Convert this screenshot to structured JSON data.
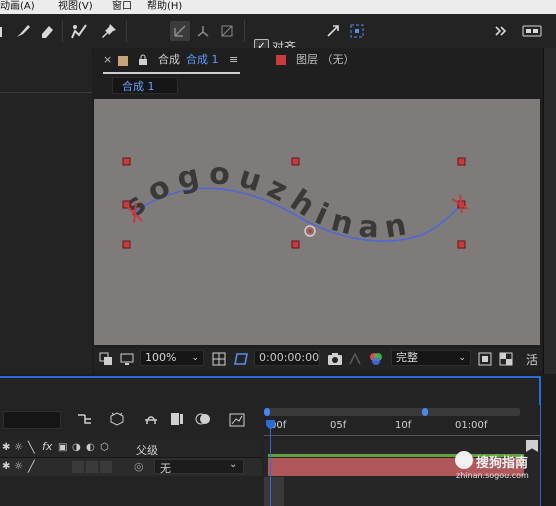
{
  "menu": {
    "items": [
      "动画(A)",
      "视图(V)",
      "窗口",
      "帮助(H)"
    ]
  },
  "toolbar": {
    "snap_label": "对齐",
    "snap_checked": true,
    "icons": [
      "paint-brush-icon",
      "eraser-icon",
      "roto-brush-icon",
      "puppet-pin-icon",
      "axis-local-icon",
      "axis-world-icon",
      "axis-view-icon",
      "snap-icon",
      "expand-icon",
      "workspace-icon"
    ]
  },
  "composition_panel": {
    "close_symbol": "×",
    "lock_symbol": "🔒",
    "title_prefix": "合成",
    "title_active": "合成 1",
    "menu_symbol": "≡",
    "layer_tab": "图层 （无）",
    "subtab": "合成 1",
    "accent_color": "#c9a27a"
  },
  "canvas": {
    "text": "sogouzhinan",
    "text_color": "#3b3838",
    "background": "#7f7b7a",
    "path_color": "#4e67d8"
  },
  "viewer_controls": {
    "zoom": "100%",
    "timecode": "0:00:00:00",
    "resolution": "完整",
    "truncated_label": "活"
  },
  "timeline": {
    "ruler_labels": [
      "00f",
      "05f",
      "10f",
      "01:00f"
    ],
    "column_header": "父级",
    "layer_parent_value": "无",
    "watermark_text": "搜狗指南",
    "watermark_url": "zhinan.sogou.com",
    "playhead_color": "#2a6bd6",
    "track_color": "#b0575a"
  }
}
